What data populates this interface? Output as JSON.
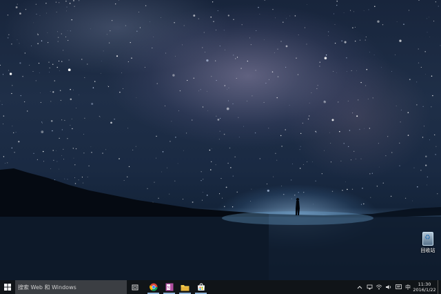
{
  "desktop": {
    "wallpaper": "starry-night-milky-way",
    "icons": [
      {
        "label": "回收站",
        "icon": "recycle-bin-icon"
      }
    ]
  },
  "taskbar": {
    "start_icon": "windows-logo-icon",
    "search_placeholder": "搜索 Web 和 Windows",
    "task_view_icon": "task-view-icon",
    "pinned": [
      {
        "name": "chrome",
        "icon": "chrome-icon"
      },
      {
        "name": "onenote",
        "icon": "onenote-icon"
      },
      {
        "name": "file-explorer",
        "icon": "folder-icon"
      },
      {
        "name": "store",
        "icon": "store-icon"
      }
    ],
    "tray": {
      "icons": [
        "chevron-up-icon",
        "network-icon",
        "wifi-icon",
        "volume-icon",
        "action-center-icon"
      ],
      "ime": "中",
      "time": "11:30",
      "date": "2016/1/22"
    }
  },
  "colors": {
    "taskbar_bg": "#101418",
    "search_bg": "#3b3e43",
    "running_indicator": "#8fb3d6"
  }
}
